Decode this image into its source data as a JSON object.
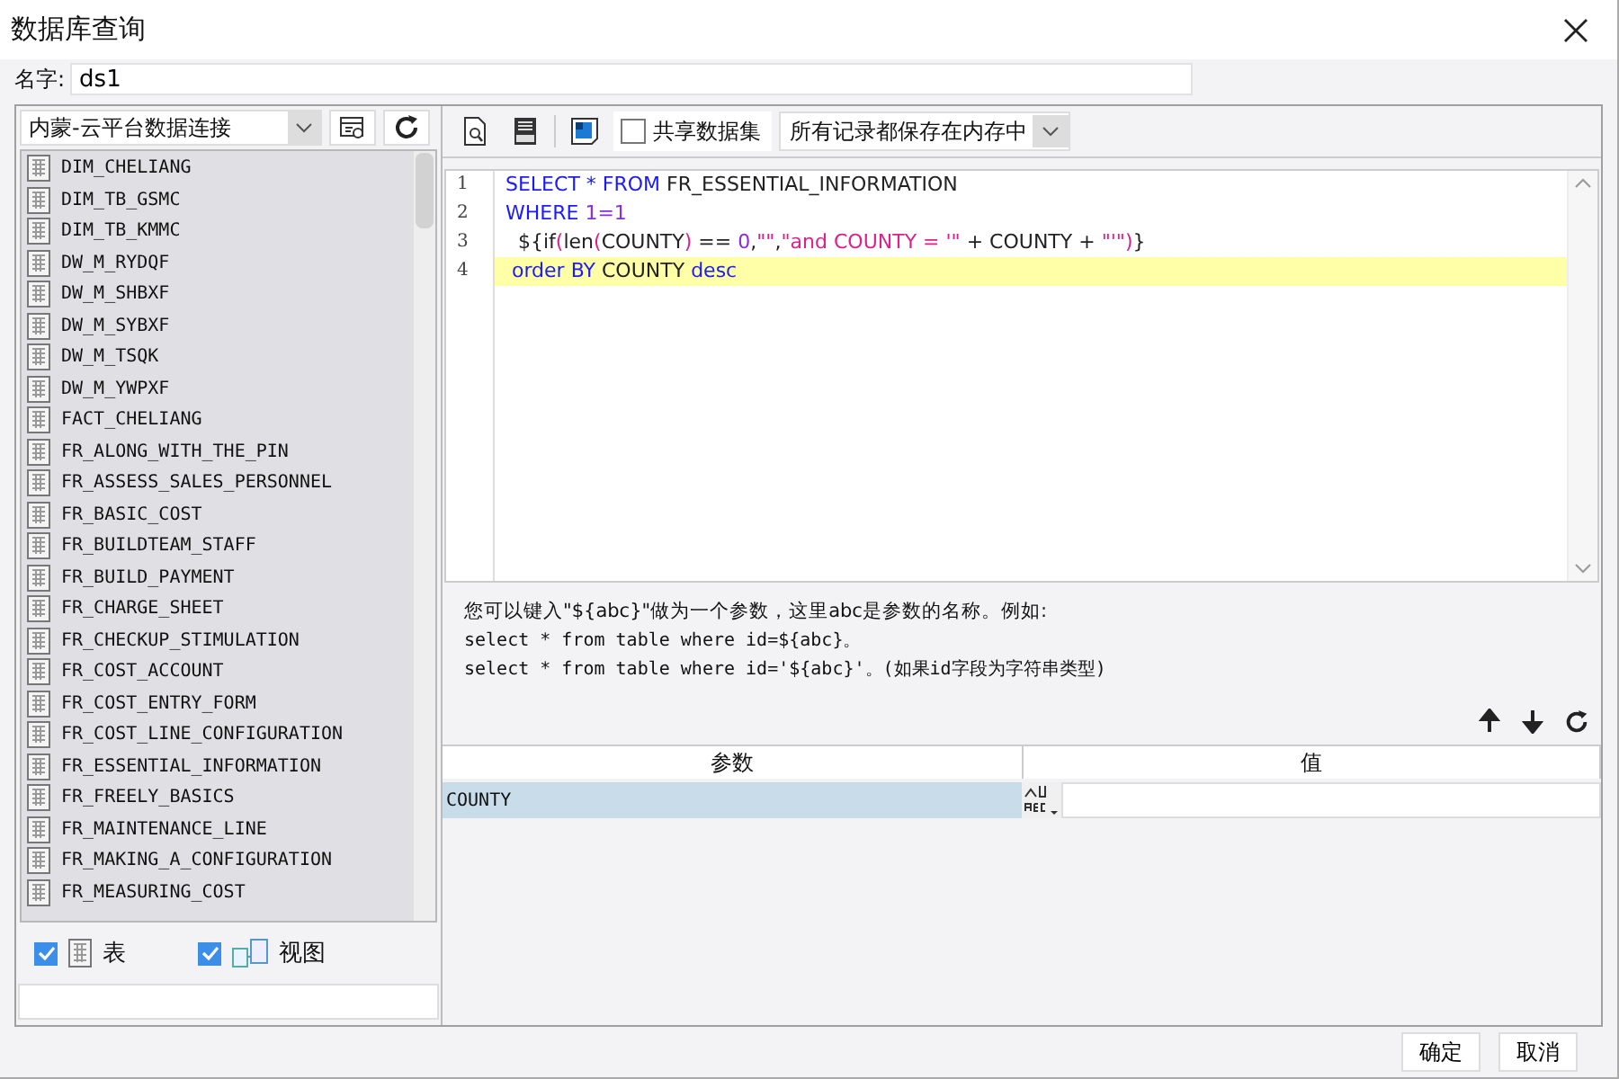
{
  "window": {
    "title": "数据库查询"
  },
  "name_field": {
    "label": "名字:",
    "value": "ds1"
  },
  "connection": {
    "value": "内蒙-云平台数据连接"
  },
  "tables": [
    {
      "name": "DIM_CHELIANG"
    },
    {
      "name": "DIM_TB_GSMC"
    },
    {
      "name": "DIM_TB_KMMC"
    },
    {
      "name": "DW_M_RYDQF"
    },
    {
      "name": "DW_M_SHBXF"
    },
    {
      "name": "DW_M_SYBXF"
    },
    {
      "name": "DW_M_TSQK"
    },
    {
      "name": "DW_M_YWPXF"
    },
    {
      "name": "FACT_CHELIANG"
    },
    {
      "name": "FR_ALONG_WITH_THE_PIN"
    },
    {
      "name": "FR_ASSESS_SALES_PERSONNEL"
    },
    {
      "name": "FR_BASIC_COST"
    },
    {
      "name": "FR_BUILDTEAM_STAFF"
    },
    {
      "name": "FR_BUILD_PAYMENT"
    },
    {
      "name": "FR_CHARGE_SHEET"
    },
    {
      "name": "FR_CHECKUP_STIMULATION"
    },
    {
      "name": "FR_COST_ACCOUNT"
    },
    {
      "name": "FR_COST_ENTRY_FORM"
    },
    {
      "name": "FR_COST_LINE_CONFIGURATION"
    },
    {
      "name": "FR_ESSENTIAL_INFORMATION"
    },
    {
      "name": "FR_FREELY_BASICS"
    },
    {
      "name": "FR_MAINTENANCE_LINE"
    },
    {
      "name": "FR_MAKING_A_CONFIGURATION"
    },
    {
      "name": "FR_MEASURING_COST"
    }
  ],
  "filters": [
    {
      "label": "表",
      "checked": true,
      "kind": "table"
    },
    {
      "label": "视图",
      "checked": true,
      "kind": "view"
    }
  ],
  "share_dataset": {
    "label": "共享数据集",
    "checked": false
  },
  "storage_mode": {
    "value": "所有记录都保存在内存中"
  },
  "sql_lines": [
    {
      "number": "1",
      "highlighted": false,
      "tokens": [
        {
          "text": "SELECT",
          "kind": "keyword"
        },
        {
          "text": " * ",
          "kind": "keyword"
        },
        {
          "text": "FROM",
          "kind": "keyword"
        },
        {
          "text": " FR_ESSENTIAL_INFORMATION",
          "kind": "plain"
        }
      ]
    },
    {
      "number": "2",
      "highlighted": false,
      "tokens": [
        {
          "text": "WHERE",
          "kind": "keyword"
        },
        {
          "text": " 1=1",
          "kind": "number"
        }
      ]
    },
    {
      "number": "3",
      "highlighted": false,
      "tokens": [
        {
          "text": "  ${if",
          "kind": "plain"
        },
        {
          "text": "(",
          "kind": "paren"
        },
        {
          "text": "len",
          "kind": "plain"
        },
        {
          "text": "(",
          "kind": "paren"
        },
        {
          "text": "COUNTY",
          "kind": "plain"
        },
        {
          "text": ")",
          "kind": "paren"
        },
        {
          "text": " == ",
          "kind": "plain"
        },
        {
          "text": "0",
          "kind": "number"
        },
        {
          "text": ",",
          "kind": "plain"
        },
        {
          "text": "\"\"",
          "kind": "string"
        },
        {
          "text": ",",
          "kind": "plain"
        },
        {
          "text": "\"and COUNTY = '\"",
          "kind": "string"
        },
        {
          "text": " + COUNTY + ",
          "kind": "plain"
        },
        {
          "text": "\"'\"",
          "kind": "string"
        },
        {
          "text": ")",
          "kind": "paren"
        },
        {
          "text": "}",
          "kind": "plain"
        }
      ]
    },
    {
      "number": "4",
      "highlighted": true,
      "tokens": [
        {
          "text": " order BY",
          "kind": "keyword"
        },
        {
          "text": " COUNTY ",
          "kind": "plain"
        },
        {
          "text": "desc",
          "kind": "keyword"
        }
      ]
    }
  ],
  "hint_lines": [
    "您可以键入\"${abc}\"做为一个参数，这里abc是参数的名称。例如:",
    "select * from table where id=${abc}。",
    "select * from table where id='${abc}'。(如果id字段为字符串类型)"
  ],
  "params_table": {
    "columns": [
      "参数",
      "值"
    ],
    "rows": [
      {
        "name": "COUNTY",
        "value": "",
        "selected": true
      }
    ]
  },
  "buttons": [
    "确定",
    "取消"
  ]
}
